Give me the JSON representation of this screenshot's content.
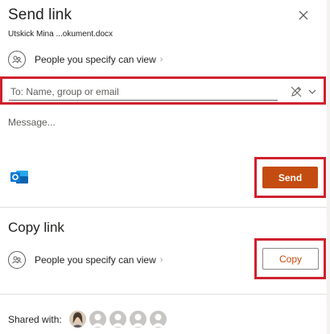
{
  "header": {
    "title": "Send link",
    "filename": "Utskick Mina ...okument.docx",
    "close_icon": "close-icon"
  },
  "send_section": {
    "permission_label": "People you specify can view",
    "permission_chevron": "›",
    "to_placeholder": "To: Name, group or email",
    "to_value": "",
    "message_placeholder": "Message...",
    "send_label": "Send"
  },
  "copy_section": {
    "title": "Copy link",
    "permission_label": "People you specify can view",
    "permission_chevron": "›",
    "copy_label": "Copy"
  },
  "shared": {
    "label": "Shared with:",
    "avatars": [
      "photo",
      "placeholder",
      "placeholder",
      "placeholder",
      "placeholder"
    ]
  },
  "colors": {
    "accent": "#c54c10",
    "highlight_border": "#d0202e",
    "outlook_blue": "#0078d4"
  }
}
